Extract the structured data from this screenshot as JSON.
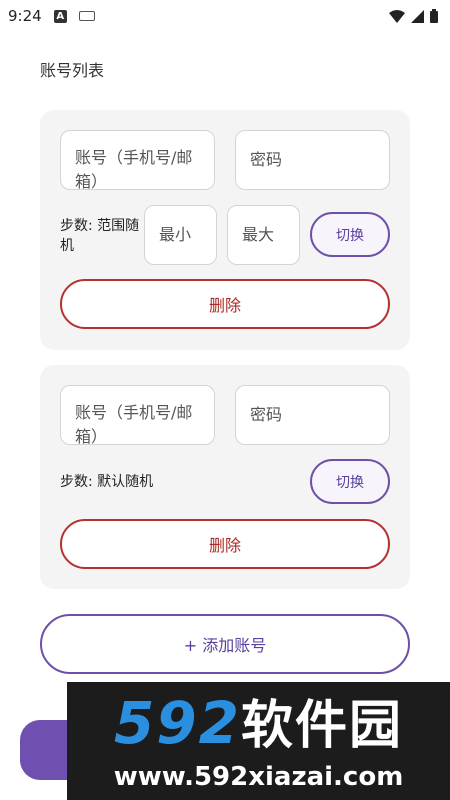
{
  "status_bar": {
    "time": "9:24",
    "a_badge": "A",
    "icons": [
      "keyboard-icon",
      "wifi-icon",
      "signal-icon",
      "battery-icon"
    ]
  },
  "page": {
    "title": "账号列表"
  },
  "accounts": [
    {
      "account_placeholder": "账号（手机号/邮箱）",
      "password_placeholder": "密码",
      "steps_label": "步数: 范围随机",
      "min_placeholder": "最小",
      "max_placeholder": "最大",
      "switch_label": "切换",
      "delete_label": "删除"
    },
    {
      "account_placeholder": "账号（手机号/邮箱）",
      "password_placeholder": "密码",
      "steps_label": "步数: 默认随机",
      "switch_label": "切换",
      "delete_label": "删除"
    }
  ],
  "add_button": {
    "label": "+ 添加账号"
  },
  "watermark": {
    "logo_digits": "592",
    "logo_text": "软件园",
    "url": "www.592xiazai.com"
  },
  "colors": {
    "accent": "#6e50a8",
    "danger": "#b3322e",
    "card_bg": "#f4f4f4"
  }
}
